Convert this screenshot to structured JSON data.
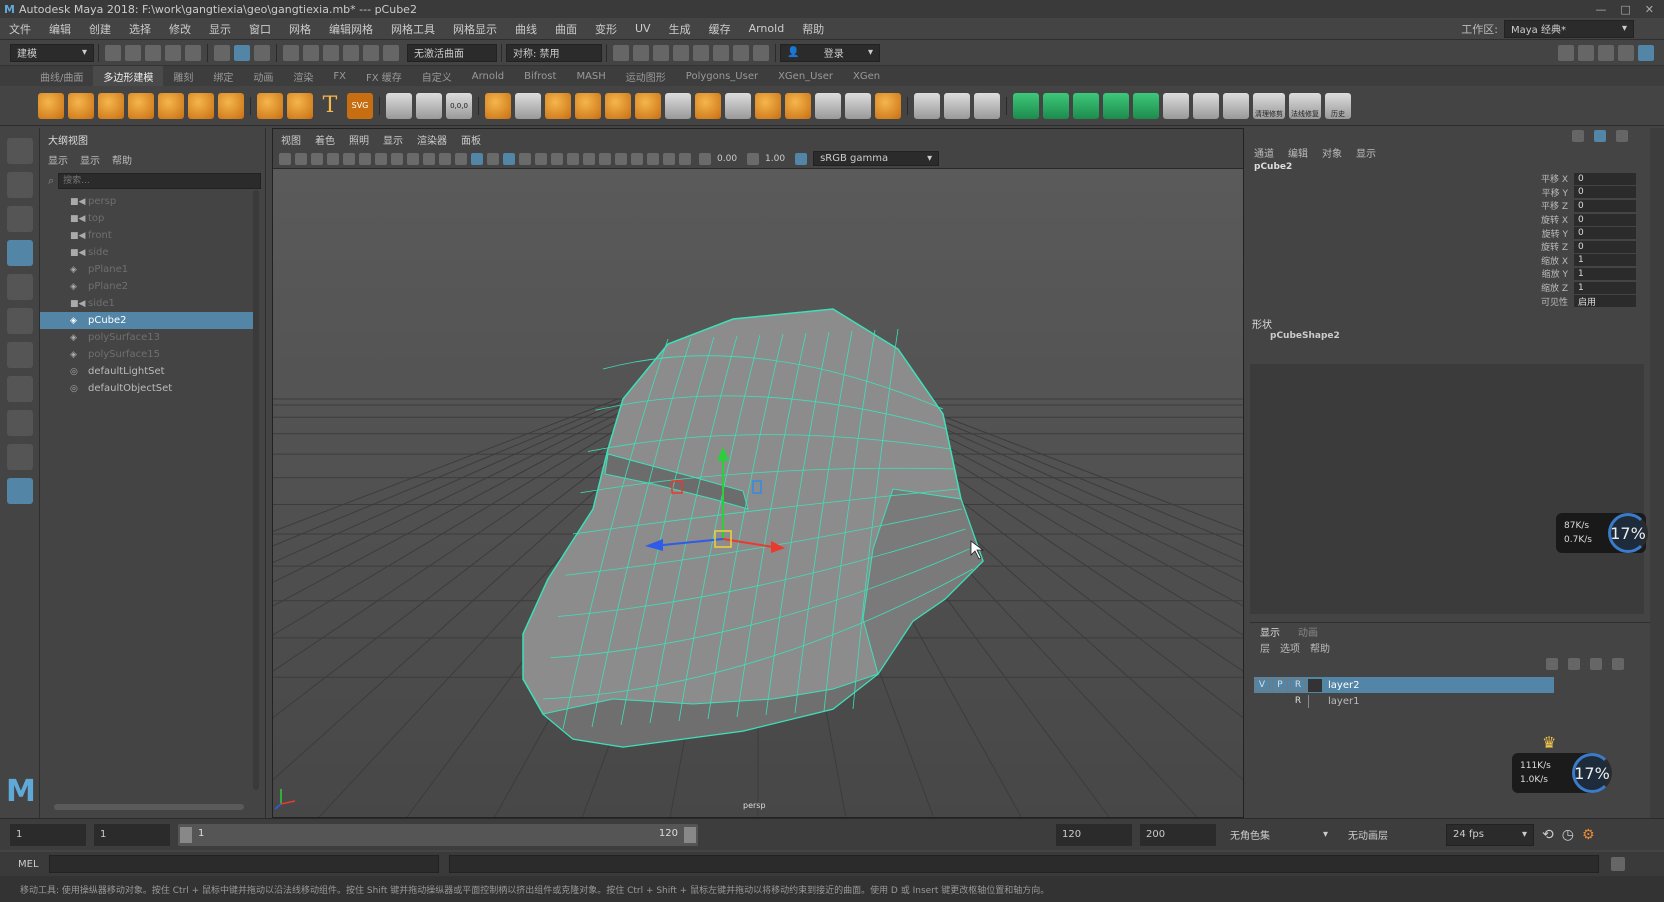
{
  "window": {
    "title": "Autodesk Maya 2018: F:\\work\\gangtiexia\\geo\\gangtiexia.mb*   ---   pCube2",
    "workspace_label": "工作区:",
    "workspace_value": "Maya 经典*"
  },
  "menu": [
    "文件",
    "编辑",
    "创建",
    "选择",
    "修改",
    "显示",
    "窗口",
    "网格",
    "编辑网格",
    "网格工具",
    "网格显示",
    "曲线",
    "曲面",
    "变形",
    "UV",
    "生成",
    "缓存",
    "Arnold",
    "帮助"
  ],
  "statusline": {
    "mode": "建模",
    "live_surface": "无激活曲面",
    "symmetry": "对称: 禁用",
    "login": "登录"
  },
  "shelf_tabs": [
    "曲线/曲面",
    "多边形建模",
    "雕刻",
    "绑定",
    "动画",
    "渲染",
    "FX",
    "FX 缓存",
    "自定义",
    "Arnold",
    "Bifrost",
    "MASH",
    "运动图形",
    "Polygons_User",
    "XGen_User",
    "XGen"
  ],
  "shelf_active_tab": "多边形建模",
  "shelf_icon_labels": [
    "T",
    "SVG",
    "0,0,0",
    "清理修剪",
    "法线修复",
    "历史"
  ],
  "outliner": {
    "title": "大纲视图",
    "menu": [
      "显示",
      "显示",
      "帮助"
    ],
    "search_placeholder": "搜索...",
    "items": [
      {
        "name": "persp",
        "type": "camera",
        "dim": true
      },
      {
        "name": "top",
        "type": "camera",
        "dim": true
      },
      {
        "name": "front",
        "type": "camera",
        "dim": true
      },
      {
        "name": "side",
        "type": "camera",
        "dim": true
      },
      {
        "name": "pPlane1",
        "type": "mesh",
        "dim": true
      },
      {
        "name": "pPlane2",
        "type": "mesh",
        "dim": true
      },
      {
        "name": "side1",
        "type": "camera",
        "dim": true
      },
      {
        "name": "pCube2",
        "type": "mesh",
        "dim": false,
        "selected": true
      },
      {
        "name": "polySurface13",
        "type": "mesh",
        "dim": true
      },
      {
        "name": "polySurface15",
        "type": "mesh",
        "dim": true
      },
      {
        "name": "defaultLightSet",
        "type": "set",
        "dim": false
      },
      {
        "name": "defaultObjectSet",
        "type": "set",
        "dim": false
      }
    ]
  },
  "viewport": {
    "menu": [
      "视图",
      "着色",
      "照明",
      "显示",
      "渲染器",
      "面板"
    ],
    "exposure": "0.00",
    "gamma": "1.00",
    "color_space": "sRGB gamma",
    "camera_label": "persp"
  },
  "channelbox": {
    "menu": [
      "通道",
      "编辑",
      "对象",
      "显示"
    ],
    "object": "pCube2",
    "channels": [
      {
        "label": "平移 X",
        "value": "0"
      },
      {
        "label": "平移 Y",
        "value": "0"
      },
      {
        "label": "平移 Z",
        "value": "0"
      },
      {
        "label": "旋转 X",
        "value": "0"
      },
      {
        "label": "旋转 Y",
        "value": "0"
      },
      {
        "label": "旋转 Z",
        "value": "0"
      },
      {
        "label": "缩放 X",
        "value": "1"
      },
      {
        "label": "缩放 Y",
        "value": "1"
      },
      {
        "label": "缩放 Z",
        "value": "1"
      },
      {
        "label": "可见性",
        "value": "启用"
      }
    ],
    "shapes_label": "形状",
    "shape_name": "pCubeShape2"
  },
  "layers": {
    "tabs": [
      "显示",
      "动画"
    ],
    "menu": [
      "层",
      "选项",
      "帮助"
    ],
    "rows": [
      {
        "v": "V",
        "p": "P",
        "r": "R",
        "name": "layer2",
        "selected": true
      },
      {
        "v": "",
        "p": "",
        "r": "R",
        "name": "layer1",
        "selected": false
      }
    ]
  },
  "net_widgets": [
    {
      "up": "87K/s",
      "down": "0.7K/s",
      "percent": "17%"
    },
    {
      "up": "111K/s",
      "down": "1.0K/s",
      "percent": "17%"
    }
  ],
  "timeslider": {
    "start": "1",
    "start2": "1",
    "range_start": "1",
    "range_end": "120",
    "end": "120",
    "end2": "200",
    "character": "无角色集",
    "anim_layer": "无动画层",
    "fps": "24 fps"
  },
  "cmdline": {
    "label": "MEL"
  },
  "helpline": "移动工具: 使用操纵器移动对象。按住 Ctrl + 鼠标中键并拖动以沿法线移动组件。按住 Shift 键并拖动操纵器或平面控制柄以挤出组件或克隆对象。按住 Ctrl + Shift + 鼠标左键并拖动以将移动约束到接近的曲面。使用 D 或 Insert 键更改枢轴位置和轴方向。"
}
